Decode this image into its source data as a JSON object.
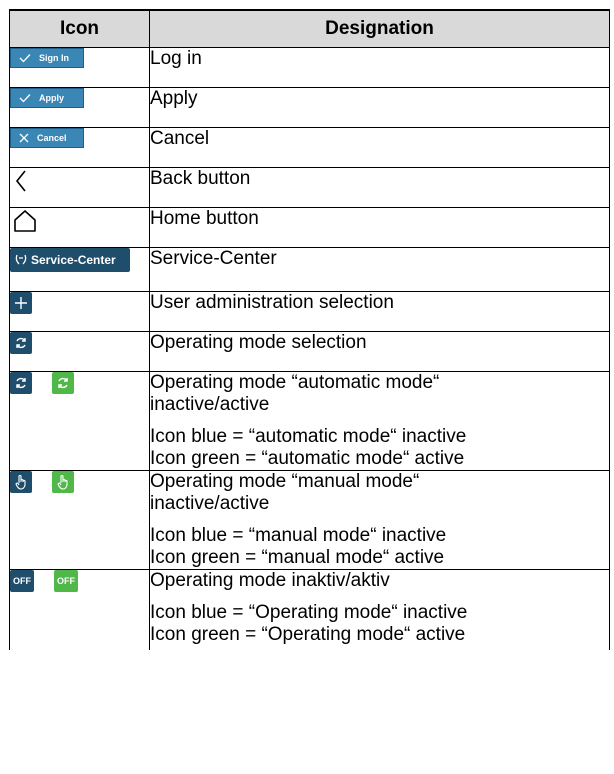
{
  "header": {
    "icon": "Icon",
    "designation": "Designation"
  },
  "rows": [
    {
      "icon": "sign-in-button-icon",
      "button_label": "Sign In",
      "designation": "Log in"
    },
    {
      "icon": "apply-button-icon",
      "button_label": "Apply",
      "designation": "Apply"
    },
    {
      "icon": "cancel-button-icon",
      "button_label": "Cancel",
      "designation": "Cancel"
    },
    {
      "icon": "chevron-left-icon",
      "designation": "Back button"
    },
    {
      "icon": "home-icon",
      "designation": "Home button"
    },
    {
      "icon": "service-center-button-icon",
      "button_label": "Service-Center",
      "designation": "Service-Center"
    },
    {
      "icon": "plus-icon",
      "designation": "User administration selection"
    },
    {
      "icon": "refresh-icon",
      "designation": "Operating mode selection"
    },
    {
      "icon": "refresh-icon",
      "designation": "Operating mode “automatic mode“ inactive/active",
      "note_1": "Icon blue = “automatic mode“ inactive",
      "note_2": "Icon green = “automatic mode“ active"
    },
    {
      "icon": "hand-pointer-icon",
      "designation": "Operating mode “manual mode“ inactive/active",
      "note_1": "Icon blue = “manual mode“ inactive",
      "note_2": "Icon green = “manual mode“ active"
    },
    {
      "icon": "off-icon",
      "button_label": "OFF",
      "designation": "Operating mode inaktiv/aktiv",
      "note_1": "Icon blue = “Operating mode“ inactive",
      "note_2": "Icon green = “Operating mode“ active"
    }
  ],
  "colors": {
    "button_blue": "#3a86b5",
    "dark_blue": "#1f4e6d",
    "green": "#4fb848",
    "header_grey": "#d9d9d9"
  }
}
